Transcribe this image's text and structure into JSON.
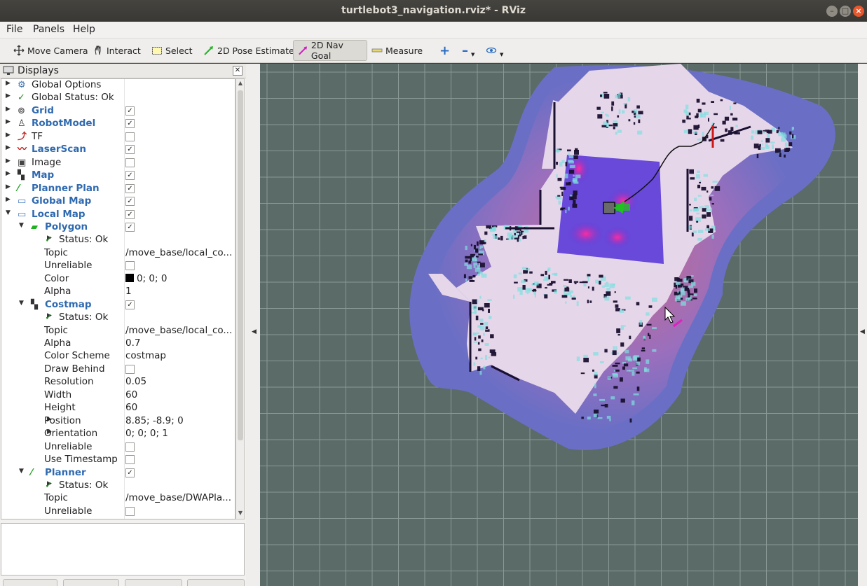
{
  "window": {
    "title": "turtlebot3_navigation.rviz* - RViz"
  },
  "menu": [
    "File",
    "Panels",
    "Help"
  ],
  "toolbar": {
    "tools": [
      {
        "label": "Move Camera",
        "icon": "move-camera-icon"
      },
      {
        "label": "Interact",
        "icon": "hand-icon"
      },
      {
        "label": "Select",
        "icon": "select-rect-icon"
      },
      {
        "label": "2D Pose Estimate",
        "icon": "green-arrow-icon"
      },
      {
        "label": "2D Nav Goal",
        "icon": "magenta-arrow-icon",
        "active": true
      },
      {
        "label": "Measure",
        "icon": "ruler-icon"
      }
    ],
    "extra_icons": [
      "plus-icon",
      "minus-icon",
      "eye-icon"
    ]
  },
  "displays_panel": {
    "title": "Displays",
    "rows": [
      {
        "name": "Global Options",
        "indent": 0,
        "expand": "collapsed",
        "icon": "gear-icon"
      },
      {
        "name": "Global Status: Ok",
        "indent": 0,
        "expand": "collapsed",
        "icon": "check-icon"
      },
      {
        "name": "Grid",
        "indent": 0,
        "expand": "collapsed",
        "icon": "grid-icon",
        "bold": true,
        "checked": true
      },
      {
        "name": "RobotModel",
        "indent": 0,
        "expand": "collapsed",
        "icon": "robot-icon",
        "bold": true,
        "checked": true
      },
      {
        "name": "TF",
        "indent": 0,
        "expand": "collapsed",
        "icon": "tf-icon",
        "checked": false
      },
      {
        "name": "LaserScan",
        "indent": 0,
        "expand": "collapsed",
        "icon": "laser-icon",
        "bold": true,
        "checked": true
      },
      {
        "name": "Image",
        "indent": 0,
        "expand": "collapsed",
        "icon": "image-icon",
        "checked": false
      },
      {
        "name": "Map",
        "indent": 0,
        "expand": "collapsed",
        "icon": "map-icon",
        "bold": true,
        "checked": true
      },
      {
        "name": "Planner Plan",
        "indent": 0,
        "expand": "collapsed",
        "icon": "path-icon",
        "bold": true,
        "checked": true
      },
      {
        "name": "Global Map",
        "indent": 0,
        "expand": "collapsed",
        "icon": "folder-icon",
        "bold": true,
        "checked": true
      },
      {
        "name": "Local Map",
        "indent": 0,
        "expand": "expanded",
        "icon": "folder-icon",
        "bold": true,
        "checked": true
      },
      {
        "name": "Polygon",
        "indent": 1,
        "expand": "expanded",
        "icon": "polygon-icon",
        "bold": true,
        "checked": true
      },
      {
        "name": "Status: Ok",
        "indent": 2,
        "expand": "collapsed",
        "icon": "check-icon"
      },
      {
        "name": "Topic",
        "indent": 2,
        "value": "/move_base/local_co..."
      },
      {
        "name": "Unreliable",
        "indent": 2,
        "checked": false
      },
      {
        "name": "Color",
        "indent": 2,
        "value": "0; 0; 0",
        "swatch": "#000000"
      },
      {
        "name": "Alpha",
        "indent": 2,
        "value": "1"
      },
      {
        "name": "Costmap",
        "indent": 1,
        "expand": "expanded",
        "icon": "map-icon",
        "bold": true,
        "checked": true
      },
      {
        "name": "Status: Ok",
        "indent": 2,
        "expand": "collapsed",
        "icon": "check-icon"
      },
      {
        "name": "Topic",
        "indent": 2,
        "value": "/move_base/local_co..."
      },
      {
        "name": "Alpha",
        "indent": 2,
        "value": "0.7"
      },
      {
        "name": "Color Scheme",
        "indent": 2,
        "value": "costmap"
      },
      {
        "name": "Draw Behind",
        "indent": 2,
        "checked": false
      },
      {
        "name": "Resolution",
        "indent": 2,
        "value": "0.05"
      },
      {
        "name": "Width",
        "indent": 2,
        "value": "60"
      },
      {
        "name": "Height",
        "indent": 2,
        "value": "60"
      },
      {
        "name": "Position",
        "indent": 2,
        "expand": "collapsed",
        "value": "8.85; -8.9; 0"
      },
      {
        "name": "Orientation",
        "indent": 2,
        "expand": "collapsed",
        "value": "0; 0; 0; 1"
      },
      {
        "name": "Unreliable",
        "indent": 2,
        "checked": false
      },
      {
        "name": "Use Timestamp",
        "indent": 2,
        "checked": false
      },
      {
        "name": "Planner",
        "indent": 1,
        "expand": "expanded",
        "icon": "path-icon",
        "bold": true,
        "checked": true
      },
      {
        "name": "Status: Ok",
        "indent": 2,
        "expand": "collapsed",
        "icon": "check-icon"
      },
      {
        "name": "Topic",
        "indent": 2,
        "value": "/move_base/DWAPla..."
      },
      {
        "name": "Unreliable",
        "indent": 2,
        "checked": false
      }
    ]
  },
  "colors": {
    "grid_bg": "#5b6b68",
    "grid_line": "#8a9996",
    "costmap_halo": "#6a6fc5",
    "free_space": "#e8d7ea",
    "local_costmap": "#5a3ad8",
    "obstacle": "#1a1030",
    "inflation": "#7fe0e0",
    "pose_arrow": "#20c020",
    "goal_arrow": "#e020c0",
    "path": "#111111"
  }
}
